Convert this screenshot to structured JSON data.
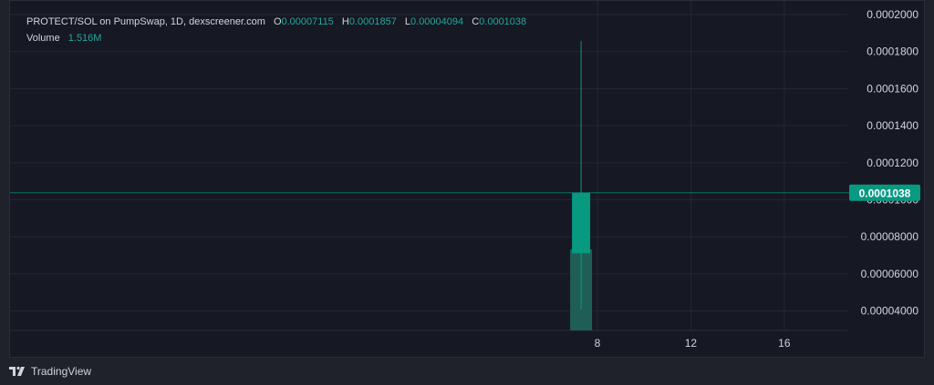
{
  "legend": {
    "symbol_line": "PROTECT/SOL on PumpSwap, 1D, dexscreener.com",
    "open_key": "O",
    "open_value": "0.00007115",
    "high_key": "H",
    "high_value": "0.0001857",
    "low_key": "L",
    "low_value": "0.00004094",
    "close_key": "C",
    "close_value": "0.0001038",
    "volume_label": "Volume",
    "volume_value": "1.516M"
  },
  "footer": {
    "brand": "TradingView",
    "logo_icon": "tradingview-logo-icon"
  },
  "colors": {
    "up": "#089981",
    "volume": "#1e5e57",
    "grid": "#242734",
    "axis_text": "#d1d4dc",
    "price_tag_bg": "#089981"
  },
  "chart_data": {
    "type": "candlestick",
    "candles": [
      {
        "x": 7.3,
        "open": 7.115e-05,
        "high": 0.0001857,
        "low": 4.094e-05,
        "close": 0.0001038,
        "volume": 1516000
      }
    ],
    "y_ticks": [
      "0.0002000",
      "0.0001800",
      "0.0001600",
      "0.0001400",
      "0.0001200",
      "0.0001000",
      "0.00008000",
      "0.00006000",
      "0.00004000"
    ],
    "y_tick_values": [
      0.0002,
      0.00018,
      0.00016,
      0.00014,
      0.00012,
      0.0001,
      8e-05,
      6e-05,
      4e-05
    ],
    "x_ticks": [
      "8",
      "12",
      "16"
    ],
    "x_tick_values": [
      8,
      12,
      16
    ],
    "ylim": [
      2.95e-05,
      0.0002
    ],
    "xlim": [
      -17.15,
      18.7
    ],
    "last_price_label": "0.0001038",
    "last_price": 0.0001038,
    "grid": true
  }
}
